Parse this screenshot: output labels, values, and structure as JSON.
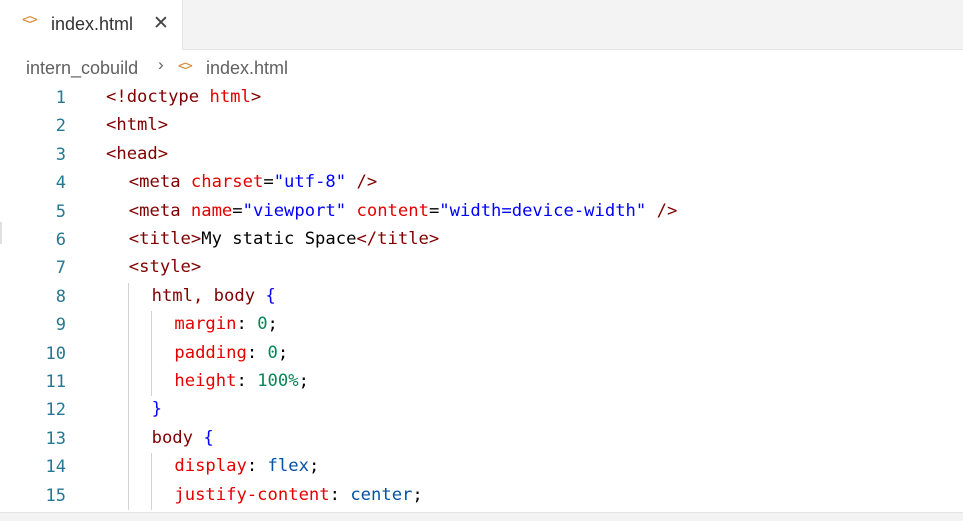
{
  "tab": {
    "icon": "html-code-icon",
    "icon_glyph": "<>",
    "label": "index.html",
    "close_glyph": "✕"
  },
  "breadcrumb": {
    "folder": "intern_cobuild",
    "separator": "›",
    "file_icon_glyph": "<>",
    "file": "index.html"
  },
  "editor": {
    "lines": [
      {
        "n": "1",
        "indent": 0,
        "tokens": [
          [
            "tag",
            "<!doctype "
          ],
          [
            "attr",
            "html"
          ],
          [
            "tag",
            ">"
          ]
        ]
      },
      {
        "n": "2",
        "indent": 0,
        "tokens": [
          [
            "tag",
            "<html>"
          ]
        ]
      },
      {
        "n": "3",
        "indent": 0,
        "tokens": [
          [
            "tag",
            "<head>"
          ]
        ]
      },
      {
        "n": "4",
        "indent": 1,
        "tokens": [
          [
            "tag",
            "<meta "
          ],
          [
            "attr",
            "charset"
          ],
          [
            "text",
            "="
          ],
          [
            "str",
            "\"utf-8\""
          ],
          [
            "text",
            " "
          ],
          [
            "tag",
            "/>"
          ]
        ]
      },
      {
        "n": "5",
        "indent": 1,
        "tokens": [
          [
            "tag",
            "<meta "
          ],
          [
            "attr",
            "name"
          ],
          [
            "text",
            "="
          ],
          [
            "str",
            "\"viewport\""
          ],
          [
            "text",
            " "
          ],
          [
            "attr",
            "content"
          ],
          [
            "text",
            "="
          ],
          [
            "str",
            "\"width=device-width\""
          ],
          [
            "text",
            " "
          ],
          [
            "tag",
            "/>"
          ]
        ]
      },
      {
        "n": "6",
        "indent": 1,
        "tokens": [
          [
            "tag",
            "<title>"
          ],
          [
            "text",
            "My static Space"
          ],
          [
            "tag",
            "</title>"
          ]
        ]
      },
      {
        "n": "7",
        "indent": 1,
        "tokens": [
          [
            "tag",
            "<style>"
          ]
        ]
      },
      {
        "n": "8",
        "indent": 2,
        "tokens": [
          [
            "sel",
            "html, body "
          ],
          [
            "brace",
            "{"
          ]
        ]
      },
      {
        "n": "9",
        "indent": 3,
        "tokens": [
          [
            "prop",
            "margin"
          ],
          [
            "text",
            ": "
          ],
          [
            "num",
            "0"
          ],
          [
            "text",
            ";"
          ]
        ]
      },
      {
        "n": "10",
        "indent": 3,
        "tokens": [
          [
            "prop",
            "padding"
          ],
          [
            "text",
            ": "
          ],
          [
            "num",
            "0"
          ],
          [
            "text",
            ";"
          ]
        ]
      },
      {
        "n": "11",
        "indent": 3,
        "tokens": [
          [
            "prop",
            "height"
          ],
          [
            "text",
            ": "
          ],
          [
            "num",
            "100%"
          ],
          [
            "text",
            ";"
          ]
        ]
      },
      {
        "n": "12",
        "indent": 2,
        "tokens": [
          [
            "brace",
            "}"
          ]
        ]
      },
      {
        "n": "13",
        "indent": 2,
        "tokens": [
          [
            "sel",
            "body "
          ],
          [
            "brace",
            "{"
          ]
        ]
      },
      {
        "n": "14",
        "indent": 3,
        "tokens": [
          [
            "prop",
            "display"
          ],
          [
            "text",
            ": "
          ],
          [
            "val",
            "flex"
          ],
          [
            "text",
            ";"
          ]
        ]
      },
      {
        "n": "15",
        "indent": 3,
        "tokens": [
          [
            "prop",
            "justify-content"
          ],
          [
            "text",
            ": "
          ],
          [
            "val",
            "center"
          ],
          [
            "text",
            ";"
          ]
        ]
      }
    ]
  },
  "colors": {
    "tag": "#800000",
    "attribute": "#e50000",
    "string": "#0000ff",
    "number": "#098658",
    "value": "#0451a5",
    "line_number": "#237893",
    "html_icon": "#d4862e"
  }
}
